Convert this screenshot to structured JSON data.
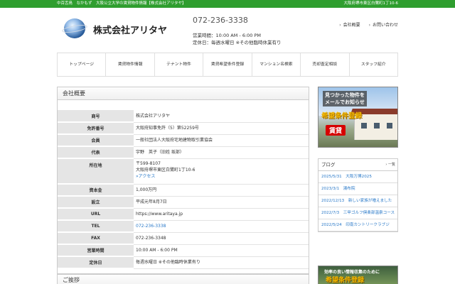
{
  "topbar": {
    "left": "中百舌鳥　なかもず　大阪公立大学の賃貸物件情報【株式会社アリタヤ】",
    "right": "大阪府堺市東区白鷺町1丁10-6"
  },
  "header": {
    "company": "株式会社アリタヤ",
    "tel": "072-236-3338",
    "hours": "営業時間：10:00 AM - 6:00 PM",
    "holiday": "定休日：毎週水曜日 ※その他臨時休業有り",
    "links": [
      "会社概要",
      "お問い合わせ"
    ]
  },
  "nav": [
    "トップページ",
    "賃貸物件情報",
    "テナント物件",
    "賃貸希望条件登録",
    "マンション名検索",
    "売却査定相談",
    "スタッフ紹介"
  ],
  "main": {
    "title": "会社概要",
    "rows": [
      {
        "label": "商号",
        "value": "株式会社アリタヤ"
      },
      {
        "label": "免許番号",
        "value": "大阪府知事免許（5）第52259号"
      },
      {
        "label": "会員",
        "value": "一般社団法人大阪府宅地建物取引業協会"
      },
      {
        "label": "代表",
        "value": "宇野　英子（旧姓 坂部）"
      },
      {
        "label": "所在地",
        "value": "〒599-8107",
        "value2": "大阪府堺市東区白鷺町1丁10-6",
        "link": "»アクセス"
      },
      {
        "label": "資本金",
        "value": "1,000万円"
      },
      {
        "label": "設立",
        "value": "平成元年8月7日"
      },
      {
        "label": "URL",
        "value": "https://www.aritaya.jp"
      },
      {
        "label": "TEL",
        "value": "072-236-3338"
      },
      {
        "label": "FAX",
        "value": "072-236-3348"
      },
      {
        "label": "営業時間",
        "value": "10:00 AM - 6:00 PM"
      },
      {
        "label": "定休日",
        "value": "毎週水曜日 ※その他臨時休業有り"
      }
    ],
    "next_title": "ご挨拶"
  },
  "side": {
    "banner": {
      "line1": "見つかった物件を",
      "line2": "メールでお知らせ",
      "line3": "希望条件登録",
      "line4": "賃貸"
    },
    "blog": {
      "title": "ブログ",
      "more": "一覧",
      "items": [
        "2025/5/31　大阪万博2025",
        "2023/3/1　湯布院",
        "2022/12/13　新しい家族が増えました",
        "2022/7/3　三甲ゴルフ倶楽部温泉コース",
        "2022/5/24　印南カントリークラブジ"
      ]
    },
    "banner2": {
      "line1": "効率の良い情報収集のために",
      "line2": "希望条件登録"
    }
  }
}
